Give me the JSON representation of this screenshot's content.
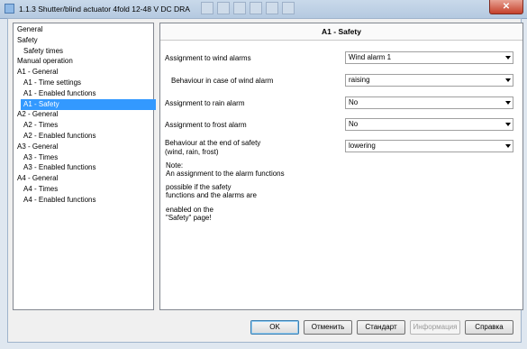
{
  "window": {
    "title": "1.1.3 Shutter/blind actuator 4fold 12-48 V DC DRA",
    "close_label": "✕"
  },
  "tree": {
    "items": [
      {
        "label": "General",
        "indent": 0
      },
      {
        "label": "Safety",
        "indent": 0
      },
      {
        "label": "Safety times",
        "indent": 1
      },
      {
        "label": "Manual operation",
        "indent": 0
      },
      {
        "label": "A1 - General",
        "indent": 0
      },
      {
        "label": "A1 - Time settings",
        "indent": 1
      },
      {
        "label": "A1 - Enabled functions",
        "indent": 1
      },
      {
        "label": "A1 - Safety",
        "indent": 1,
        "selected": true
      },
      {
        "label": "A2 - General",
        "indent": 0
      },
      {
        "label": "A2 - Times",
        "indent": 1
      },
      {
        "label": "A2 - Enabled functions",
        "indent": 1
      },
      {
        "label": "A3 - General",
        "indent": 0
      },
      {
        "label": "A3 - Times",
        "indent": 1
      },
      {
        "label": "A3 - Enabled functions",
        "indent": 1
      },
      {
        "label": "A4 - General",
        "indent": 0
      },
      {
        "label": "A4 - Times",
        "indent": 1
      },
      {
        "label": "A4 - Enabled functions",
        "indent": 1
      }
    ]
  },
  "panel": {
    "header": "A1 - Safety",
    "params": {
      "wind_label": "Assignment to wind alarms",
      "wind_value": "Wind alarm 1",
      "wind_behaviour_label": "Behaviour in case of wind alarm",
      "wind_behaviour_value": "raising",
      "rain_label": "Assignment to rain alarm",
      "rain_value": "No",
      "frost_label": "Assignment to frost alarm",
      "frost_value": "No",
      "end_label_1": "Behaviour at the end of safety",
      "end_label_2": "(wind, rain, frost)",
      "end_value": "lowering"
    },
    "note": {
      "line1": "Note:",
      "line2": "An assignment to the alarm functions",
      "line3": "possible if the safety",
      "line4": "functions and the alarms are",
      "line5": "enabled on the",
      "line6": "\"Safety\" page!"
    }
  },
  "buttons": {
    "ok": "OK",
    "cancel": "Отменить",
    "default": "Стандарт",
    "info": "Информация",
    "help": "Справка"
  }
}
